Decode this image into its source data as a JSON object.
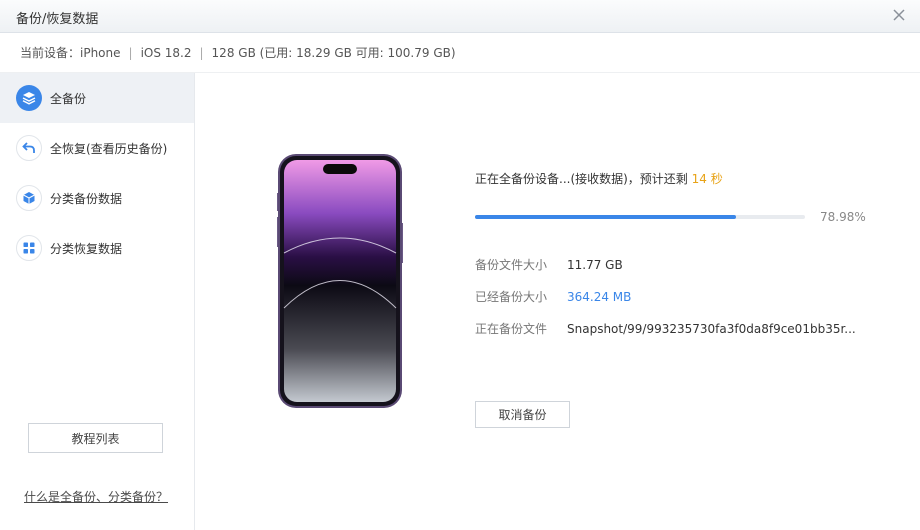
{
  "window": {
    "title": "备份/恢复数据"
  },
  "device": {
    "label": "当前设备：iPhone",
    "ios": "iOS 18.2",
    "storage": "128 GB (已用: 18.29 GB 可用: 100.79 GB)"
  },
  "sidebar": {
    "items": [
      {
        "label": "全备份",
        "icon": "layers-icon",
        "active": true
      },
      {
        "label": "全恢复(查看历史备份)",
        "icon": "undo-arrow-icon"
      },
      {
        "label": "分类备份数据",
        "icon": "cube-icon"
      },
      {
        "label": "分类恢复数据",
        "icon": "grid-icon"
      }
    ],
    "tutorial_label": "教程列表",
    "help_link": "什么是全备份、分类备份？"
  },
  "main": {
    "status_prefix": "正在全备份设备...(接收数据)，预计还剩",
    "remaining": "14 秒",
    "progress": 0.7898,
    "progress_text": "78.98%",
    "rows": [
      {
        "key": "备份文件大小",
        "value": "11.77 GB"
      },
      {
        "key": "已经备份大小",
        "value": "364.24 MB"
      },
      {
        "key": "正在备份文件",
        "value": "Snapshot/99/993235730fa3f0da8f9ce01bb35r..."
      }
    ],
    "cancel_label": "取消备份"
  },
  "colors": {
    "accent": "#3a86e8",
    "remaining": "#e8a317",
    "phone_frame": "#6b5a86"
  }
}
